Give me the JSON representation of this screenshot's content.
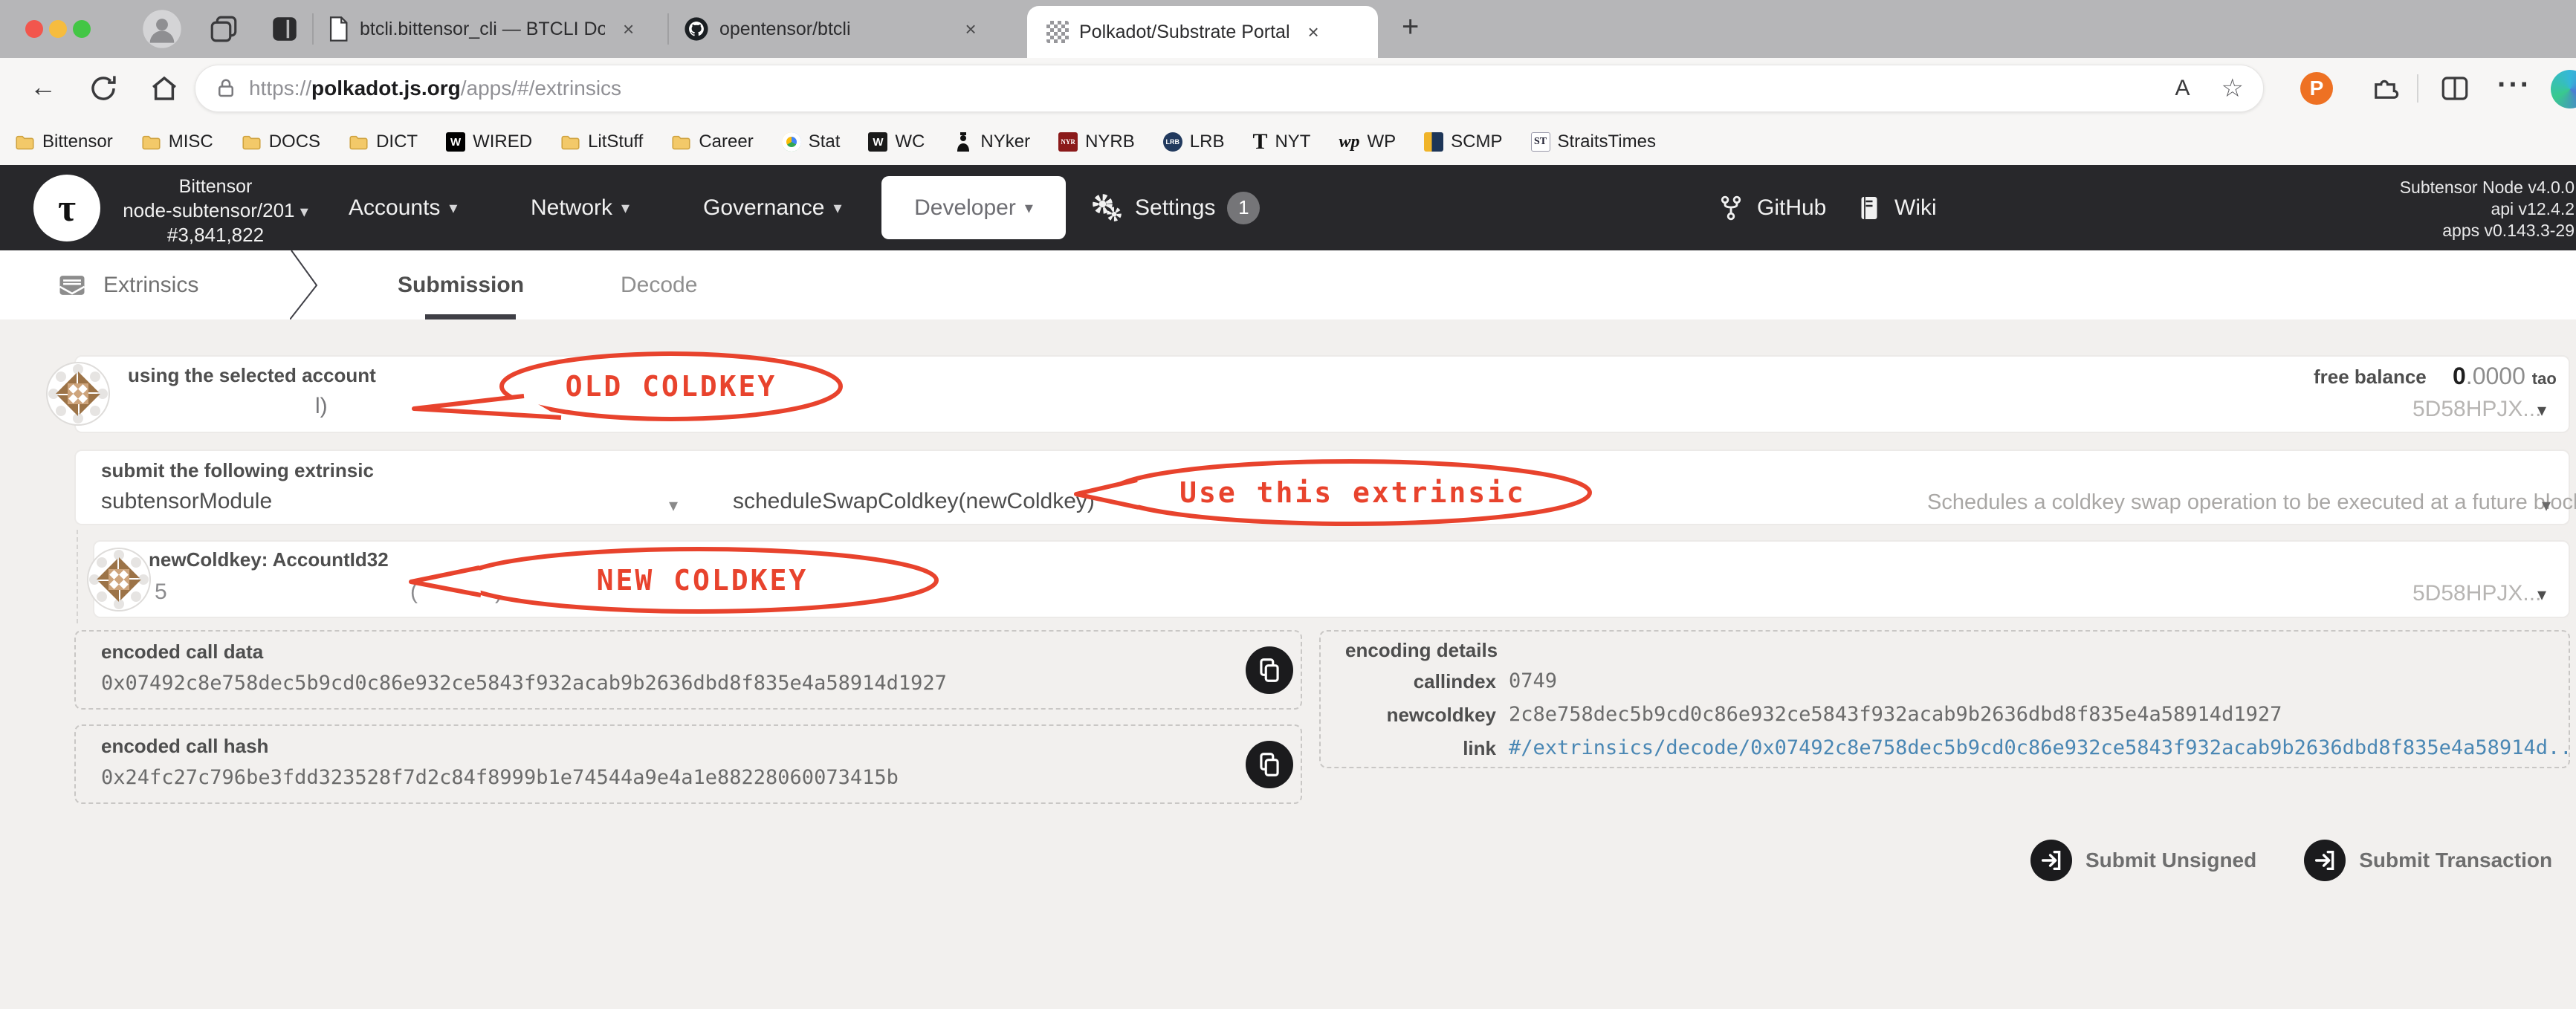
{
  "window": {
    "tabs": [
      {
        "title": "btcli.bittensor_cli — BTCLI Docs"
      },
      {
        "title": "opentensor/btcli"
      },
      {
        "title": "Polkadot/Substrate Portal"
      }
    ]
  },
  "toolbar": {
    "url_scheme": "https://",
    "url_host": "polkadot.js.org",
    "url_path": "/apps/#/extrinsics"
  },
  "icons": {
    "caret": "▾",
    "close": "×",
    "plus": "+",
    "back": "←",
    "dots": "···",
    "star": "☆",
    "reader": "A"
  },
  "bookmarks": [
    "Bittensor",
    "MISC",
    "DOCS",
    "DICT",
    "WIRED",
    "LitStuff",
    "Career",
    "Stat",
    "WC",
    "NYker",
    "NYRB",
    "LRB",
    "NYT",
    "WP",
    "SCMP",
    "StraitsTimes"
  ],
  "header": {
    "chain": "Bittensor",
    "node": "node-subtensor/201",
    "block": "#3,841,822",
    "nav_accounts": "Accounts",
    "nav_network": "Network",
    "nav_governance": "Governance",
    "nav_developer": "Developer",
    "nav_settings": "Settings",
    "settings_badge": "1",
    "github": "GitHub",
    "wiki": "Wiki",
    "versions": [
      "Subtensor Node v4.0.0",
      "api v12.4.2",
      "apps v0.143.3-29"
    ]
  },
  "page_tabs": {
    "section": "Extrinsics",
    "tab_submission": "Submission",
    "tab_decode": "Decode"
  },
  "account_row": {
    "label": "using the selected account",
    "visible_text": "l)",
    "balance_label": "free balance",
    "balance_int": "0",
    "balance_frac": ".0000",
    "balance_unit": "tao",
    "address": "5D58HPJX..."
  },
  "extrinsic_row": {
    "label": "submit the following extrinsic",
    "module": "subtensorModule",
    "method": "scheduleSwapColdkey(newColdkey)",
    "description": "Schedules a coldkey swap operation to be executed at a future block."
  },
  "new_coldkey_row": {
    "label": "newColdkey: AccountId32",
    "visible_prefix": "5",
    "visible_open": "(",
    "visible_close": ")",
    "address": "5D58HPJX..."
  },
  "call_data": {
    "label": "encoded call data",
    "value": "0x07492c8e758dec5b9cd0c86e932ce5843f932acab9b2636dbd8f835e4a58914d1927"
  },
  "call_hash": {
    "label": "encoded call hash",
    "value": "0x24fc27c796be3fdd323528f7d2c84f8999b1e74544a9e4a1e88228060073415b"
  },
  "encoding": {
    "title": "encoding details",
    "callindex_label": "callindex",
    "callindex": "0749",
    "newcoldkey_label": "newcoldkey",
    "newcoldkey": "2c8e758dec5b9cd0c86e932ce5843f932acab9b2636dbd8f835e4a58914d1927",
    "link_label": "link",
    "link": "#/extrinsics/decode/0x07492c8e758dec5b9cd0c86e932ce5843f932acab9b2636dbd8f835e4a58914d..."
  },
  "annotations": {
    "old": "OLD COLDKEY",
    "use": "Use this extrinsic",
    "new": "NEW COLDKEY"
  },
  "actions": {
    "unsigned": "Submit Unsigned",
    "signed": "Submit Transaction"
  },
  "colors": {
    "annotation_red": "#e8432d",
    "link_blue": "#4a87b4",
    "header_bg": "#28282b",
    "accent_folder": "#f3c969"
  }
}
